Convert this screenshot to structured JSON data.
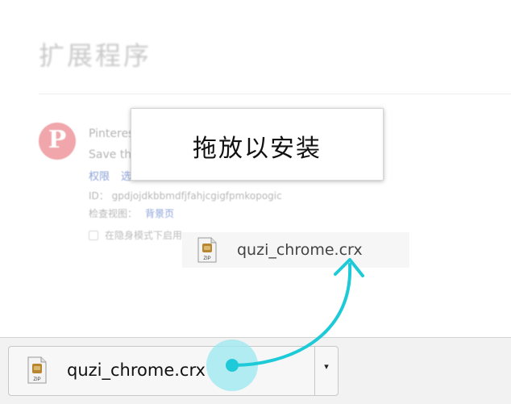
{
  "page": {
    "title": "扩展程序"
  },
  "extension": {
    "icon_letter": "P",
    "name": "Pinterest",
    "description": "Save the",
    "link_permissions": "权限",
    "link_options": "选",
    "id_text": "ID： gpdjojdkbbmdfjfahjcgigfpmkopogic",
    "views_label": "检查视图：",
    "views_link": "背景页",
    "incognito_label": "在隐身模式下启用"
  },
  "drop_box": {
    "text": "拖放以安装"
  },
  "drag_ghost": {
    "file_name": "quzi_chrome.crx",
    "icon_label": "ZIP"
  },
  "download_bar": {
    "file_name": "quzi_chrome.crx",
    "icon_label": "ZIP",
    "menu_arrow": "▾"
  },
  "colors": {
    "accent_cyan": "#1fcad8",
    "cursor_halo": "#9ee9ef",
    "link_blue": "#8ea3d8"
  }
}
